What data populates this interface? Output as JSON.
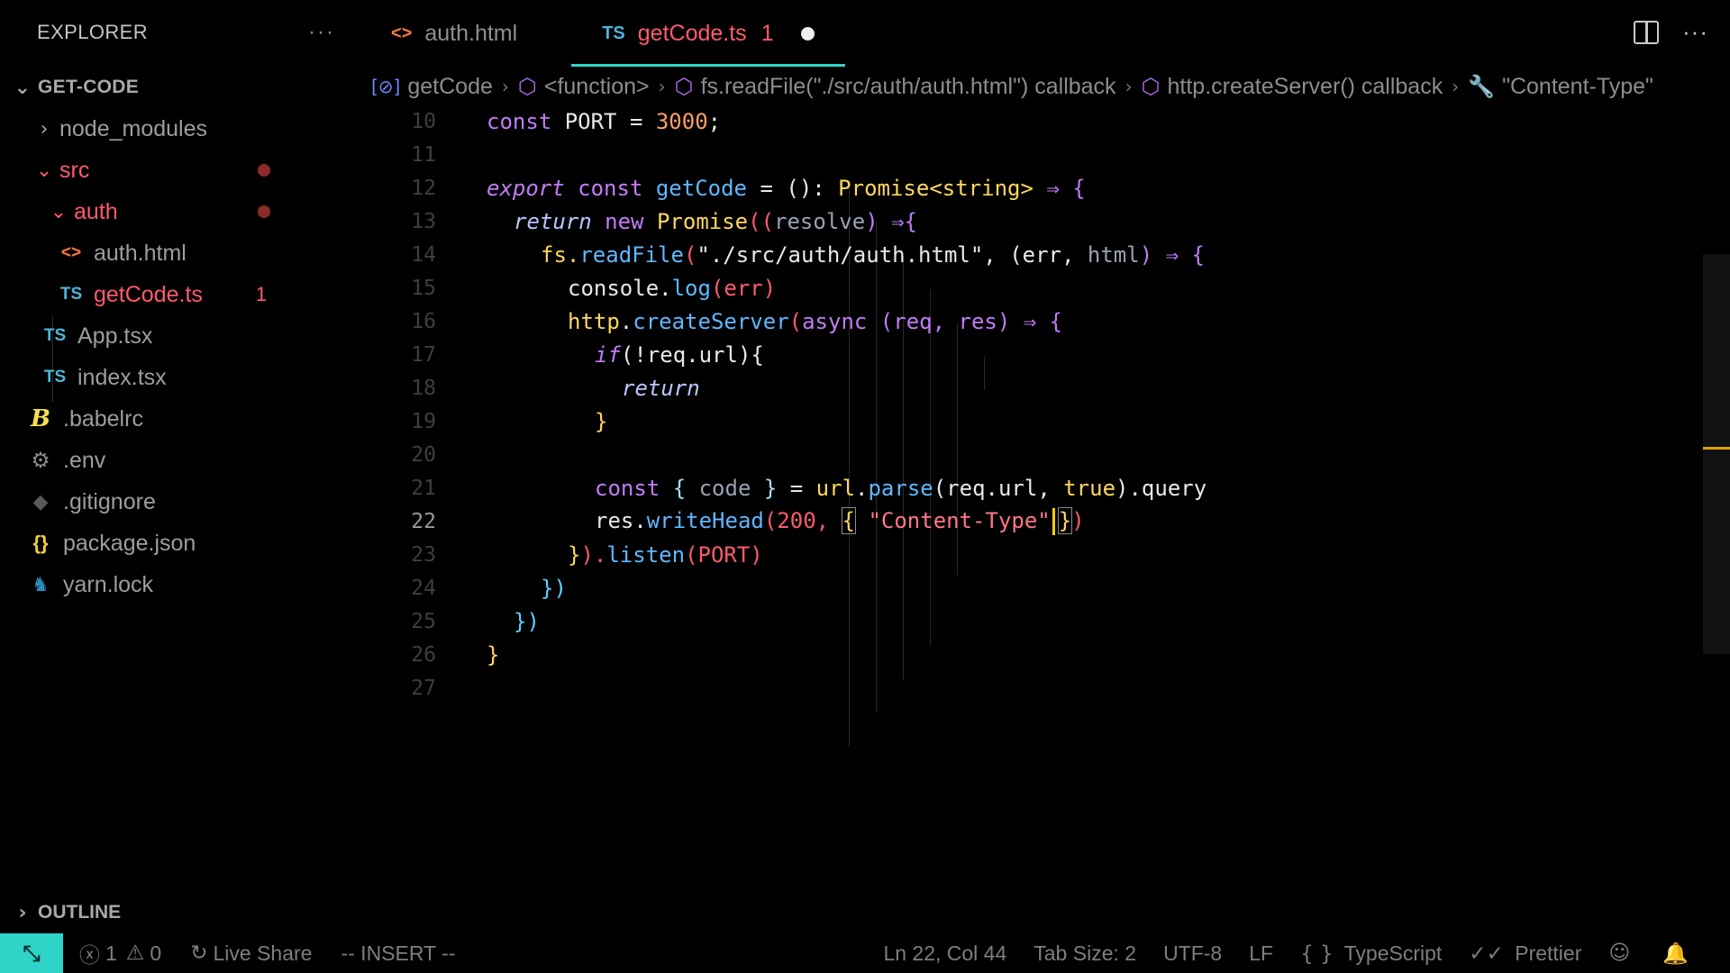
{
  "sidebar": {
    "title": "EXPLORER",
    "more": "···",
    "project": "GET-CODE",
    "items": [
      {
        "label": "node_modules",
        "icon": "chevron-right"
      },
      {
        "label": "src",
        "icon": "chevron-down"
      },
      {
        "label": "auth",
        "icon": "chevron-down"
      },
      {
        "label": "auth.html",
        "icon": "<>"
      },
      {
        "label": "getCode.ts",
        "icon": "TS",
        "errors": "1"
      },
      {
        "label": "App.tsx",
        "icon": "TS"
      },
      {
        "label": "index.tsx",
        "icon": "TS"
      },
      {
        "label": ".babelrc",
        "icon": "B"
      },
      {
        "label": ".env",
        "icon": "gear"
      },
      {
        "label": ".gitignore",
        "icon": "git"
      },
      {
        "label": "package.json",
        "icon": "{}"
      },
      {
        "label": "yarn.lock",
        "icon": "yarn"
      }
    ],
    "outline": "OUTLINE"
  },
  "tabs": [
    {
      "label": "auth.html",
      "icon": "<>"
    },
    {
      "label": "getCode.ts",
      "icon": "TS",
      "badge": "1"
    }
  ],
  "breadcrumb": [
    "getCode",
    "<function>",
    "fs.readFile(\"./src/auth/auth.html\") callback",
    "http.createServer() callback",
    "\"Content-Type\""
  ],
  "editor": {
    "line_numbers": [
      "10",
      "11",
      "12",
      "13",
      "14",
      "15",
      "16",
      "17",
      "18",
      "19",
      "20",
      "21",
      "22",
      "23",
      "24",
      "25",
      "26",
      "27"
    ],
    "current_line": "22",
    "code": {
      "l10": {
        "t1": "const",
        "t2": " PORT = ",
        "t3": "3000",
        "t4": ";"
      },
      "l12": {
        "t1": "export",
        "t2": "const",
        "t3": "getCode",
        "t4": " = (): ",
        "t5": "Promise<string>",
        "t6": " ⇒ {"
      },
      "l13": {
        "t1": "return",
        "t2": "new",
        "t3": "Promise",
        "t4": "((",
        "t5": "resolve",
        "t6": ") ⇒{"
      },
      "l14": {
        "t1": "fs.",
        "t2": "readFile",
        "t3": "(",
        "t4": "\"./src/auth/auth.html\"",
        "t5": ", (err, ",
        "t6": "html",
        "t7": ") ⇒ {"
      },
      "l15": {
        "t1": "console.",
        "t2": "log",
        "t3": "(err)"
      },
      "l16": {
        "t1": "http",
        "t2": ".",
        "t3": "createServer",
        "t4": "(",
        "t5": "async",
        "t6": " (req, res) ⇒ {"
      },
      "l17": {
        "t1": "if",
        "t2": "(!req.url){"
      },
      "l18": {
        "t1": "return"
      },
      "l19": {
        "t1": "}"
      },
      "l21": {
        "t1": "const",
        "t2": "{",
        "t3": " code ",
        "t4": "}",
        "t5": " = ",
        "t6": "url",
        "t7": ".",
        "t8": "parse",
        "t9": "(req.url, ",
        "t10": "true",
        "t11": ").query"
      },
      "l22": {
        "t1": "res.",
        "t2": "writeHead",
        "t3": "(200, ",
        "t4": "{",
        "t5": "\"Content-Type\"",
        "t6": "}",
        "t7": ")"
      },
      "l23": {
        "t1": "}",
        "t2": ").",
        "t3": "listen",
        "t4": "(PORT)"
      },
      "l24": {
        "t1": "})"
      },
      "l25": {
        "t1": "})"
      },
      "l26": {
        "t1": "}"
      }
    }
  },
  "statusbar": {
    "remote": "⤡",
    "errors": "1",
    "warnings": "0",
    "live_share": "Live Share",
    "mode": "-- INSERT --",
    "position": "Ln 22, Col 44",
    "tab_size": "Tab Size: 2",
    "encoding": "UTF-8",
    "eol": "LF",
    "language": "TypeScript",
    "formatter": "Prettier"
  },
  "colors": {
    "accent": "#2fd4c8",
    "error": "#ff5a6e",
    "background": "#000000"
  }
}
